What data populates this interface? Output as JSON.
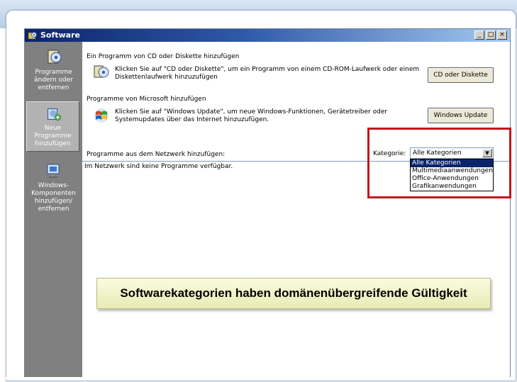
{
  "window": {
    "title": "Software",
    "minimize": "_",
    "maximize": "□",
    "close": "×"
  },
  "sidebar": {
    "items": [
      {
        "label": "Programme ändern oder entfernen",
        "icon": "change-remove-programs-icon"
      },
      {
        "label": "Neue Programme hinzufügen",
        "icon": "add-new-programs-icon",
        "active": true
      },
      {
        "label": "Windows-Komponenten hinzufügen/ entfernen",
        "icon": "windows-components-icon"
      }
    ]
  },
  "content": {
    "cd_section": {
      "heading": "Ein Programm von CD oder Diskette hinzufügen",
      "description": "Klicken Sie auf \"CD oder Diskette\", um ein Programm von einem CD-ROM-Laufwerk oder einem Diskettenlaufwerk hinzuzufügen",
      "button": "CD oder Diskette"
    },
    "ms_section": {
      "heading": "Programme von Microsoft hinzufügen",
      "description": "Klicken Sie auf \"Windows Update\", um neue Windows-Funktionen, Gerätetreiber oder Systemupdates über das Internet hinzuzufügen.",
      "button": "Windows Update"
    },
    "network_section": {
      "heading": "Programme aus dem Netzwerk hinzufügen:",
      "category_label": "Kategorie:",
      "category_value": "Alle Kategorien",
      "category_options": [
        "Alle Kategorien",
        "Multimediaanwendungen",
        "Office-Anwendungen",
        "Grafikanwendungen"
      ],
      "empty_message": "Im Netzwerk sind keine Programme verfügbar."
    }
  },
  "callout": {
    "text": "Softwarekategorien haben domänenübergreifende Gültigkeit"
  },
  "colors": {
    "highlight": "#c4161c",
    "titlebar": "#0a246a",
    "sidebar": "#808080"
  }
}
